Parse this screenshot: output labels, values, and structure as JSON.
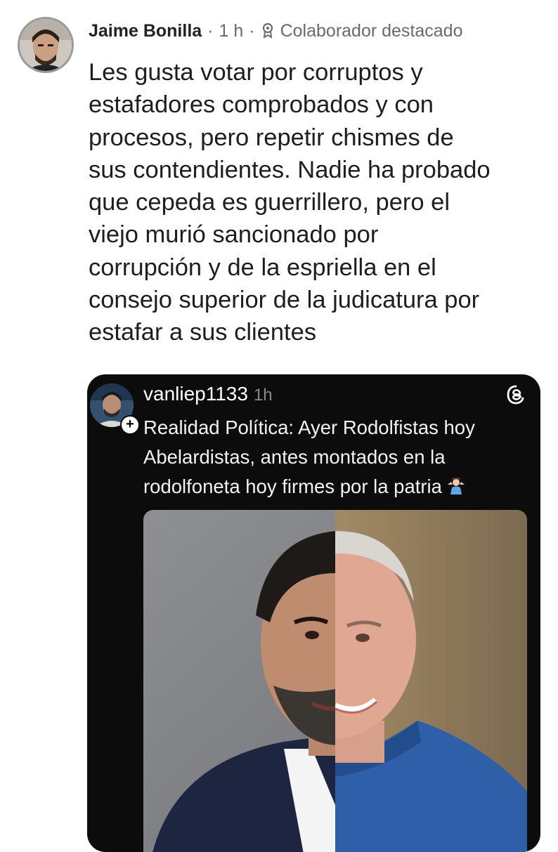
{
  "comment": {
    "author": "Jaime Bonilla",
    "separator_1": "·",
    "time": "1 h",
    "separator_2": "·",
    "badge_icon": "award-icon",
    "badge": "Colaborador destacado",
    "text": "Les gusta votar por corruptos y\nestafadores comprobados y con\nprocesos, pero repetir chismes de\nsus contendientes. Nadie ha probado\nque cepeda es guerrillero, pero el\nviejo murió sancionado por\ncorrupción y de la espriella en el\nconsejo superior de la judicatura por\nestafar a sus clientes"
  },
  "embedded_post": {
    "username": "vanliep1133",
    "time": "1h",
    "platform_icon": "threads-logo-icon",
    "follow_symbol": "+",
    "text": "Realidad Política: Ayer Rodolfistas hoy\nAbelardistas, antes montados en la\nrodolfoneta hoy firmes por la patria",
    "emoji_icon": "shrug-emoji-icon"
  },
  "colors": {
    "card_background": "#0c0c0c",
    "meta_gray": "#6a6a6a",
    "shirt_blue": "#2f5fa8",
    "suit_navy": "#1d2540"
  }
}
